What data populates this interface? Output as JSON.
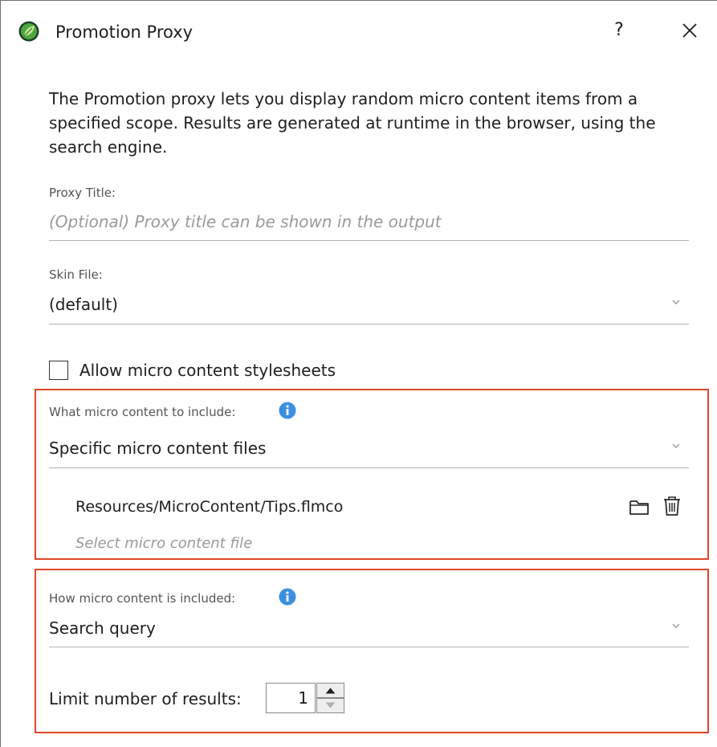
{
  "window": {
    "title": "Promotion Proxy",
    "help_label": "?",
    "icons": {
      "app": "app-logo-icon",
      "close": "close-icon"
    },
    "colors": {
      "accent_border": "#e0452a",
      "info": "#3c8fe0",
      "app_icon": "#4fa83c"
    }
  },
  "description": "The Promotion proxy lets you display random micro content items from a specified scope. Results are generated at runtime in the browser, using the search engine.",
  "proxy_title": {
    "label": "Proxy Title:",
    "value": "",
    "placeholder": "(Optional) Proxy title can be shown in the output"
  },
  "skin_file": {
    "label": "Skin File:",
    "value": "(default)"
  },
  "allow_stylesheets": {
    "label": "Allow micro content stylesheets",
    "checked": false
  },
  "what_to_include": {
    "label": "What micro content to include:",
    "value": "Specific micro content files",
    "files": [
      "Resources/MicroContent/Tips.flmco"
    ],
    "select_prompt": "Select micro content file",
    "icons": {
      "info": "info-icon",
      "browse": "folder-icon",
      "delete": "trash-icon"
    }
  },
  "how_included": {
    "label": "How micro content is included:",
    "value": "Search query",
    "limit_label": "Limit number of results:",
    "limit_value": "1"
  }
}
